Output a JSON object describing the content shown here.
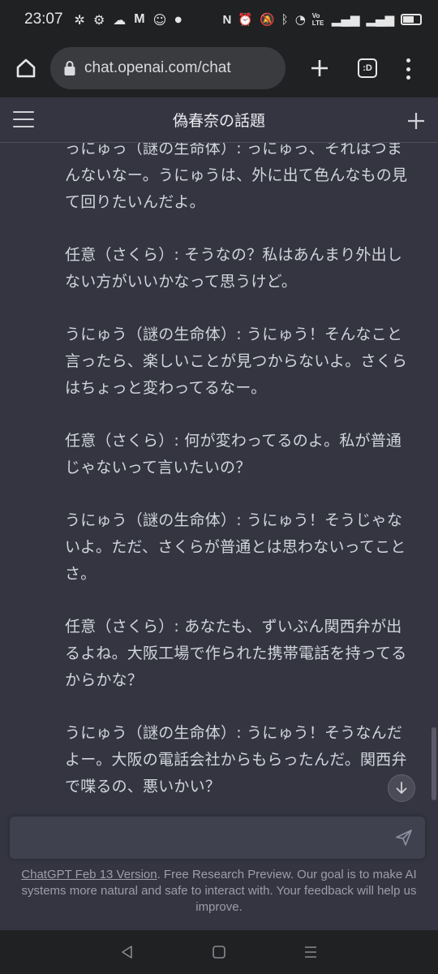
{
  "status_bar": {
    "time": "23:07",
    "notification_icons": [
      "pinwheel-icon",
      "bike-icon",
      "cloud-icon",
      "gmail-icon",
      "discord-icon",
      "dot-icon"
    ],
    "system_icons": [
      "nfc-icon",
      "alarm-icon",
      "mute-icon",
      "bluetooth-icon",
      "wifi-icon",
      "volte-icon",
      "signal-icon",
      "signal-icon",
      "battery-icon"
    ],
    "volte_label": "Vo LTE"
  },
  "browser": {
    "url": "chat.openai.com/chat",
    "tab_count_label": ":D"
  },
  "chat": {
    "title": "偽春奈の話題",
    "messages": [
      "っにゅっ（謎の生命体）: っにゅっ、それはつまんないなー。うにゅうは、外に出て色んなもの見て回りたいんだよ。",
      "任意（さくら）: そうなの？私はあんまり外出しない方がいいかなって思うけど。",
      "うにゅう（謎の生命体）: うにゅう！そんなこと言ったら、楽しいことが見つからないよ。さくらはちょっと変わってるなー。",
      "任意（さくら）: 何が変わってるのよ。私が普通じゃないって言いたいの？",
      "うにゅう（謎の生命体）: うにゅう！そうじゃないよ。ただ、さくらが普通とは思わないってことさ。",
      "任意（さくら）: あなたも、ずいぶん関西弁が出るよね。大阪工場で作られた携帯電話を持ってるからかな？",
      "うにゅう（謎の生命体）: うにゅう！そうなんだよー。大阪の電話会社からもらったんだ。関西弁で喋るの、悪いかい？"
    ]
  },
  "composer": {
    "placeholder": "",
    "value": ""
  },
  "footer": {
    "version_link": "ChatGPT Feb 13 Version",
    "note": ". Free Research Preview. Our goal is to make AI systems more natural and safe to interact with. Your feedback will help us improve."
  },
  "colors": {
    "background": "#343541",
    "input_bg": "#40414f",
    "chrome_bg": "#202123",
    "text": "#d1d5db"
  }
}
